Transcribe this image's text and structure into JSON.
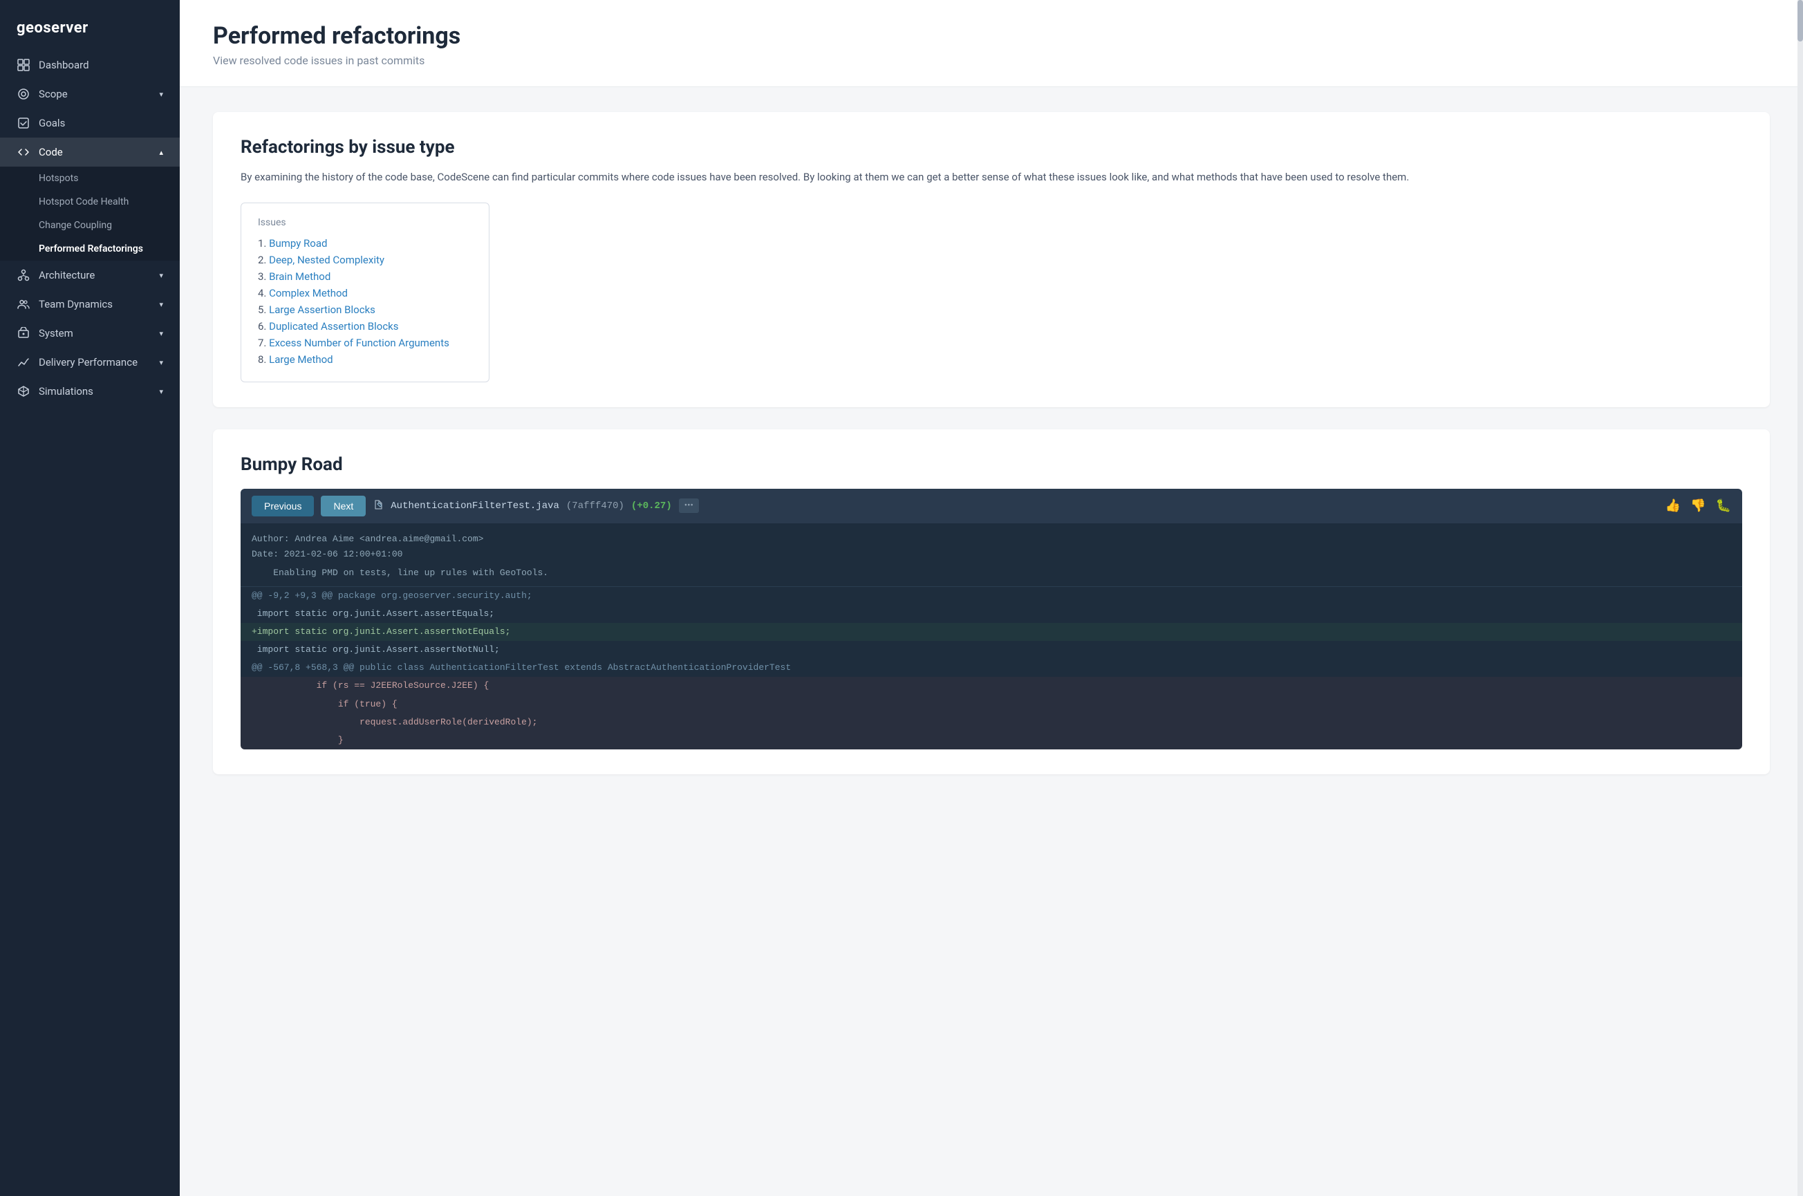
{
  "app": {
    "name": "geoserver"
  },
  "sidebar": {
    "items": [
      {
        "id": "dashboard",
        "label": "Dashboard",
        "icon": "grid"
      },
      {
        "id": "scope",
        "label": "Scope",
        "icon": "circle",
        "hasChevron": true
      },
      {
        "id": "goals",
        "label": "Goals",
        "icon": "check-square"
      },
      {
        "id": "code",
        "label": "Code",
        "icon": "code",
        "hasChevron": true,
        "expanded": true
      },
      {
        "id": "architecture",
        "label": "Architecture",
        "icon": "nodes",
        "hasChevron": true
      },
      {
        "id": "team-dynamics",
        "label": "Team Dynamics",
        "icon": "people",
        "hasChevron": true
      },
      {
        "id": "system",
        "label": "System",
        "icon": "cube",
        "hasChevron": true
      },
      {
        "id": "delivery-performance",
        "label": "Delivery Performance",
        "icon": "chart",
        "hasChevron": true
      },
      {
        "id": "simulations",
        "label": "Simulations",
        "icon": "box",
        "hasChevron": true
      }
    ],
    "code_sub_items": [
      {
        "id": "hotspots",
        "label": "Hotspots"
      },
      {
        "id": "hotspot-code-health",
        "label": "Hotspot Code Health"
      },
      {
        "id": "change-coupling",
        "label": "Change Coupling"
      },
      {
        "id": "performed-refactorings",
        "label": "Performed Refactorings",
        "active": true
      }
    ]
  },
  "page": {
    "title": "Performed refactorings",
    "subtitle": "View resolved code issues in past commits"
  },
  "refactorings_section": {
    "title": "Refactorings by issue type",
    "description": "By examining the history of the code base, CodeScene can find particular commits where code issues have been resolved. By looking at them we can get a better sense of what these issues look like, and what methods that have been used to resolve them.",
    "issues_label": "Issues",
    "issues": [
      {
        "num": 1,
        "label": "Bumpy Road"
      },
      {
        "num": 2,
        "label": "Deep, Nested Complexity"
      },
      {
        "num": 3,
        "label": "Brain Method"
      },
      {
        "num": 4,
        "label": "Complex Method"
      },
      {
        "num": 5,
        "label": "Large Assertion Blocks"
      },
      {
        "num": 6,
        "label": "Duplicated Assertion Blocks"
      },
      {
        "num": 7,
        "label": "Excess Number of Function Arguments"
      },
      {
        "num": 8,
        "label": "Large Method"
      }
    ]
  },
  "bumpy_road": {
    "title": "Bumpy Road",
    "commit": {
      "btn_previous": "Previous",
      "btn_next": "Next",
      "filename": "AuthenticationFilterTest.java",
      "hash": "(7afff470)",
      "score": "(+0.27)",
      "author": "Author: Andrea Aime <andrea.aime@gmail.com>",
      "date": "Date:   2021-02-06 12:00+01:00",
      "message": "Enabling PMD on tests, line up rules with GeoTools."
    },
    "code_lines": [
      {
        "type": "meta",
        "text": "@@ -9,2 +9,3 @@ package org.geoserver.security.auth;"
      },
      {
        "type": "neutral",
        "text": " import static org.junit.Assert.assertEquals;"
      },
      {
        "type": "added",
        "text": "+import static org.junit.Assert.assertNotEquals;"
      },
      {
        "type": "neutral",
        "text": " import static org.junit.Assert.assertNotNull;"
      },
      {
        "type": "meta",
        "text": "@@ -567,8 +568,3 @@ public class AuthenticationFilterTest extends AbstractAuthenticationProviderTest"
      },
      {
        "type": "removed",
        "text": "            if (rs == J2EERoleSource.J2EE) {"
      },
      {
        "type": "removed",
        "text": "                if (true) {"
      },
      {
        "type": "removed",
        "text": "                    request.addUserRole(derivedRole);"
      },
      {
        "type": "removed",
        "text": "                }"
      }
    ]
  }
}
